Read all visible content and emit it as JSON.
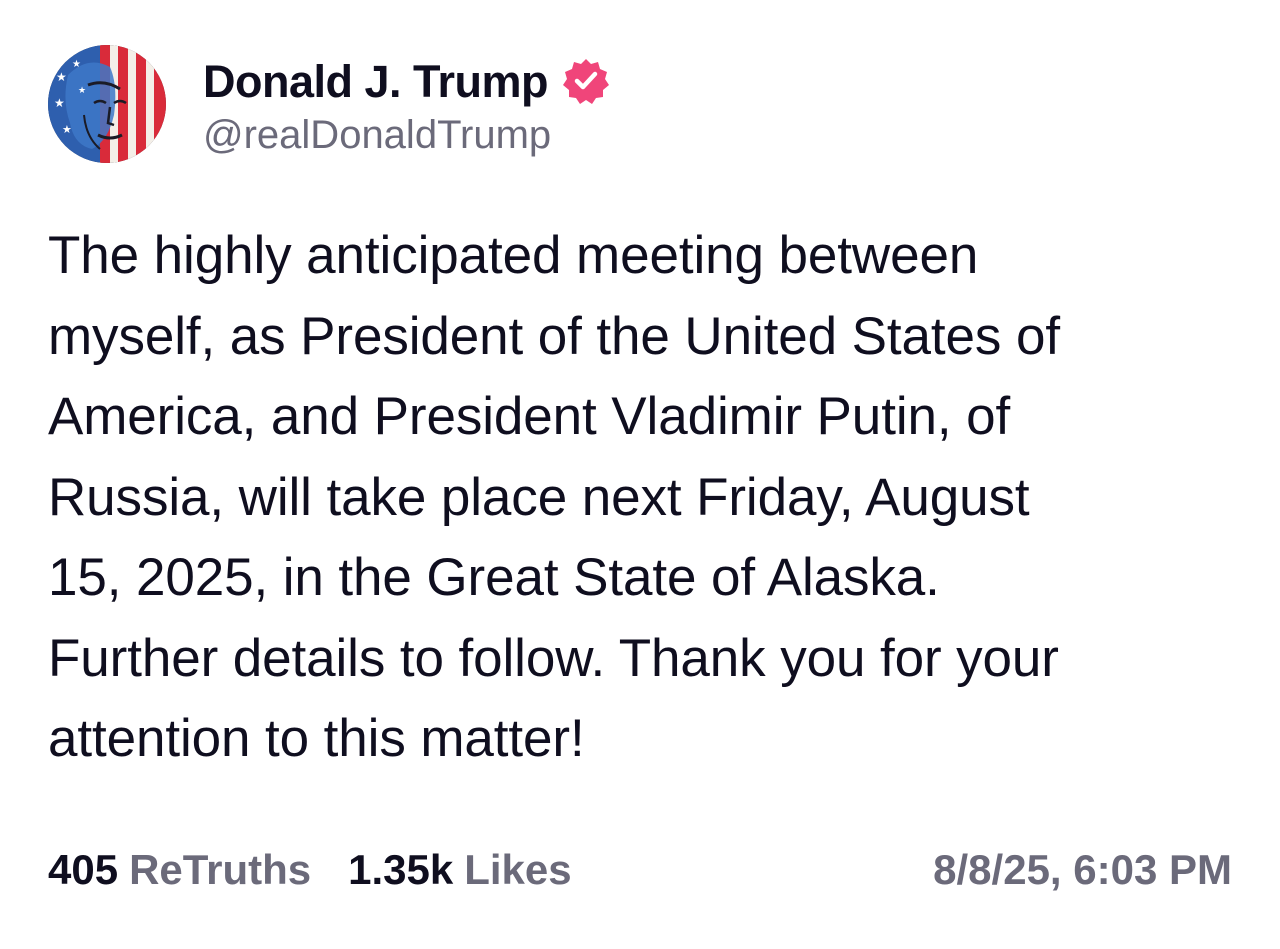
{
  "author": {
    "display_name": "Donald J. Trump",
    "handle": "@realDonaldTrump",
    "verified_icon": "verified-badge-icon",
    "verified_color": "#f0457a"
  },
  "post": {
    "text": "The highly anticipated meeting between\nmyself, as President of the United States of\nAmerica, and President Vladimir Putin, of\nRussia, will take place next Friday, August\n15, 2025, in the Great State of Alaska.\nFurther details to follow. Thank you for your\nattention to this matter!"
  },
  "stats": {
    "retruths_count": "405",
    "retruths_label": "ReTruths",
    "likes_count": "1.35k",
    "likes_label": "Likes",
    "timestamp": "8/8/25, 6:03 PM"
  },
  "colors": {
    "text_primary": "#0f0e1f",
    "text_secondary": "#6b6a7a",
    "background": "#ffffff"
  }
}
